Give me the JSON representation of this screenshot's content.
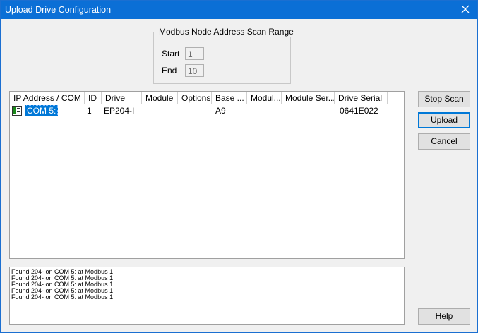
{
  "window": {
    "title": "Upload Drive Configuration"
  },
  "scan_range": {
    "label": "Modbus Node Address Scan Range",
    "start_label": "Start",
    "start_value": "1",
    "end_label": "End",
    "end_value": "10"
  },
  "table": {
    "columns": [
      "IP Address / COM",
      "ID",
      "Drive",
      "Module",
      "Options",
      "Base ...",
      "Modul...",
      "Module Ser...",
      "Drive Serial"
    ],
    "rows": [
      {
        "ip": "COM 5:",
        "id": "1",
        "drive": "EP204-I",
        "module": "",
        "options": "",
        "base": "A9",
        "modul": "",
        "module_serial": "",
        "drive_serial": "0641E022"
      }
    ]
  },
  "buttons": {
    "stop_scan": "Stop Scan",
    "upload": "Upload",
    "cancel": "Cancel",
    "help": "Help"
  },
  "log": [
    "Found 204- on COM 5: at Modbus 1",
    "Found 204- on COM 5: at Modbus 1",
    "Found 204- on COM 5: at Modbus 1",
    "Found 204- on COM 5: at Modbus 1",
    "Found 204- on COM 5: at Modbus 1"
  ]
}
